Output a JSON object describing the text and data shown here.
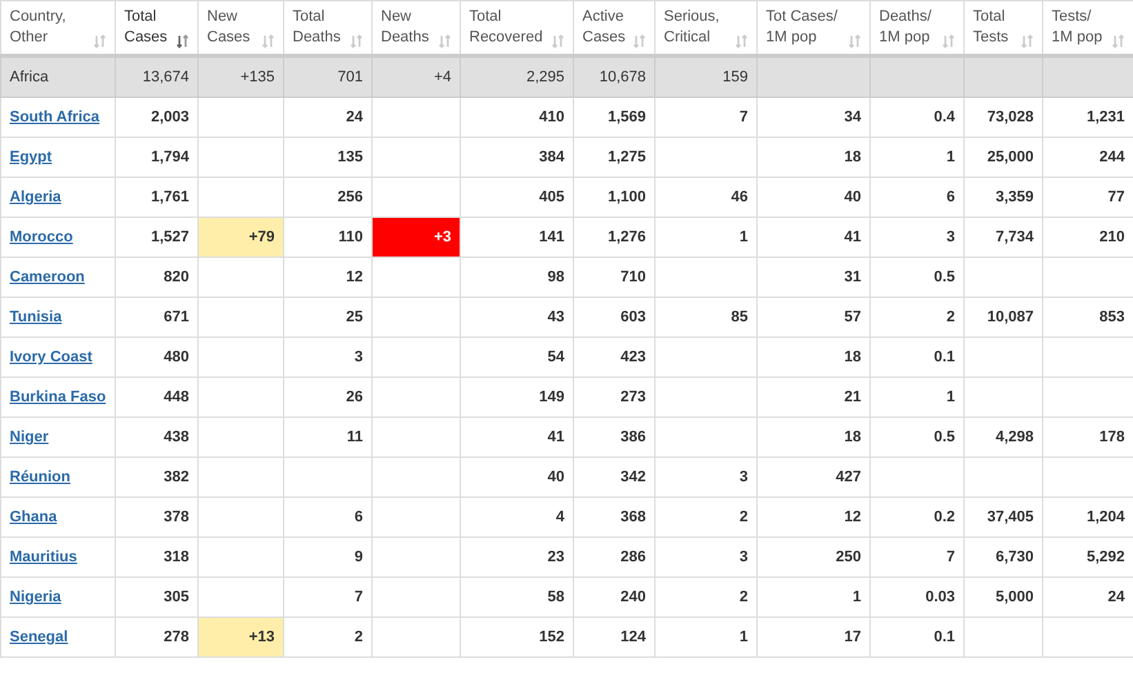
{
  "columns": [
    {
      "label": "Country, Other",
      "sorted": false
    },
    {
      "label": "Total Cases",
      "sorted": true
    },
    {
      "label": "New Cases",
      "sorted": false
    },
    {
      "label": "Total Deaths",
      "sorted": false
    },
    {
      "label": "New Deaths",
      "sorted": false
    },
    {
      "label": "Total Recovered",
      "sorted": false
    },
    {
      "label": "Active Cases",
      "sorted": false
    },
    {
      "label": "Serious, Critical",
      "sorted": false
    },
    {
      "label": "Tot Cases/ 1M pop",
      "sorted": false
    },
    {
      "label": "Deaths/ 1M pop",
      "sorted": false
    },
    {
      "label": "Total Tests",
      "sorted": false
    },
    {
      "label": "Tests/ 1M pop",
      "sorted": false
    }
  ],
  "total_row": {
    "cells": [
      "Africa",
      "13,674",
      "+135",
      "701",
      "+4",
      "2,295",
      "10,678",
      "159",
      null,
      null,
      null,
      null
    ]
  },
  "rows": [
    {
      "cells": [
        "South Africa",
        "2,003",
        null,
        "24",
        null,
        "410",
        "1,569",
        "7",
        "34",
        "0.4",
        "73,028",
        "1,231"
      ],
      "new_cases_flagged": false,
      "new_deaths_flagged": false
    },
    {
      "cells": [
        "Egypt",
        "1,794",
        null,
        "135",
        null,
        "384",
        "1,275",
        null,
        "18",
        "1",
        "25,000",
        "244"
      ],
      "new_cases_flagged": false,
      "new_deaths_flagged": false
    },
    {
      "cells": [
        "Algeria",
        "1,761",
        null,
        "256",
        null,
        "405",
        "1,100",
        "46",
        "40",
        "6",
        "3,359",
        "77"
      ],
      "new_cases_flagged": false,
      "new_deaths_flagged": false
    },
    {
      "cells": [
        "Morocco",
        "1,527",
        "+79",
        "110",
        "+3",
        "141",
        "1,276",
        "1",
        "41",
        "3",
        "7,734",
        "210"
      ],
      "new_cases_flagged": true,
      "new_deaths_flagged": true
    },
    {
      "cells": [
        "Cameroon",
        "820",
        null,
        "12",
        null,
        "98",
        "710",
        null,
        "31",
        "0.5",
        null,
        null
      ],
      "new_cases_flagged": false,
      "new_deaths_flagged": false
    },
    {
      "cells": [
        "Tunisia",
        "671",
        null,
        "25",
        null,
        "43",
        "603",
        "85",
        "57",
        "2",
        "10,087",
        "853"
      ],
      "new_cases_flagged": false,
      "new_deaths_flagged": false
    },
    {
      "cells": [
        "Ivory Coast",
        "480",
        null,
        "3",
        null,
        "54",
        "423",
        null,
        "18",
        "0.1",
        null,
        null
      ],
      "new_cases_flagged": false,
      "new_deaths_flagged": false
    },
    {
      "cells": [
        "Burkina Faso",
        "448",
        null,
        "26",
        null,
        "149",
        "273",
        null,
        "21",
        "1",
        null,
        null
      ],
      "new_cases_flagged": false,
      "new_deaths_flagged": false
    },
    {
      "cells": [
        "Niger",
        "438",
        null,
        "11",
        null,
        "41",
        "386",
        null,
        "18",
        "0.5",
        "4,298",
        "178"
      ],
      "new_cases_flagged": false,
      "new_deaths_flagged": false
    },
    {
      "cells": [
        "Réunion",
        "382",
        null,
        null,
        null,
        "40",
        "342",
        "3",
        "427",
        null,
        null,
        null
      ],
      "new_cases_flagged": false,
      "new_deaths_flagged": false
    },
    {
      "cells": [
        "Ghana",
        "378",
        null,
        "6",
        null,
        "4",
        "368",
        "2",
        "12",
        "0.2",
        "37,405",
        "1,204"
      ],
      "new_cases_flagged": false,
      "new_deaths_flagged": false
    },
    {
      "cells": [
        "Mauritius",
        "318",
        null,
        "9",
        null,
        "23",
        "286",
        "3",
        "250",
        "7",
        "6,730",
        "5,292"
      ],
      "new_cases_flagged": false,
      "new_deaths_flagged": false
    },
    {
      "cells": [
        "Nigeria",
        "305",
        null,
        "7",
        null,
        "58",
        "240",
        "2",
        "1",
        "0.03",
        "5,000",
        "24"
      ],
      "new_cases_flagged": false,
      "new_deaths_flagged": false
    },
    {
      "cells": [
        "Senegal",
        "278",
        "+13",
        "2",
        null,
        "152",
        "124",
        "1",
        "17",
        "0.1",
        null,
        null
      ],
      "new_cases_flagged": true,
      "new_deaths_flagged": false
    }
  ]
}
